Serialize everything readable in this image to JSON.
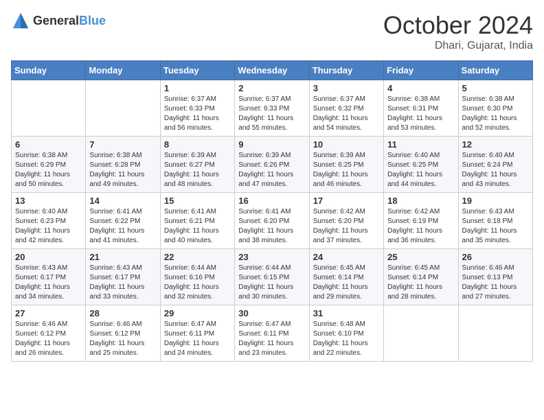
{
  "logo": {
    "text_general": "General",
    "text_blue": "Blue"
  },
  "header": {
    "month": "October 2024",
    "location": "Dhari, Gujarat, India"
  },
  "weekdays": [
    "Sunday",
    "Monday",
    "Tuesday",
    "Wednesday",
    "Thursday",
    "Friday",
    "Saturday"
  ],
  "weeks": [
    [
      {
        "day": "",
        "info": ""
      },
      {
        "day": "",
        "info": ""
      },
      {
        "day": "1",
        "info": "Sunrise: 6:37 AM\nSunset: 6:33 PM\nDaylight: 11 hours and 56 minutes."
      },
      {
        "day": "2",
        "info": "Sunrise: 6:37 AM\nSunset: 6:33 PM\nDaylight: 11 hours and 55 minutes."
      },
      {
        "day": "3",
        "info": "Sunrise: 6:37 AM\nSunset: 6:32 PM\nDaylight: 11 hours and 54 minutes."
      },
      {
        "day": "4",
        "info": "Sunrise: 6:38 AM\nSunset: 6:31 PM\nDaylight: 11 hours and 53 minutes."
      },
      {
        "day": "5",
        "info": "Sunrise: 6:38 AM\nSunset: 6:30 PM\nDaylight: 11 hours and 52 minutes."
      }
    ],
    [
      {
        "day": "6",
        "info": "Sunrise: 6:38 AM\nSunset: 6:29 PM\nDaylight: 11 hours and 50 minutes."
      },
      {
        "day": "7",
        "info": "Sunrise: 6:38 AM\nSunset: 6:28 PM\nDaylight: 11 hours and 49 minutes."
      },
      {
        "day": "8",
        "info": "Sunrise: 6:39 AM\nSunset: 6:27 PM\nDaylight: 11 hours and 48 minutes."
      },
      {
        "day": "9",
        "info": "Sunrise: 6:39 AM\nSunset: 6:26 PM\nDaylight: 11 hours and 47 minutes."
      },
      {
        "day": "10",
        "info": "Sunrise: 6:39 AM\nSunset: 6:25 PM\nDaylight: 11 hours and 46 minutes."
      },
      {
        "day": "11",
        "info": "Sunrise: 6:40 AM\nSunset: 6:25 PM\nDaylight: 11 hours and 44 minutes."
      },
      {
        "day": "12",
        "info": "Sunrise: 6:40 AM\nSunset: 6:24 PM\nDaylight: 11 hours and 43 minutes."
      }
    ],
    [
      {
        "day": "13",
        "info": "Sunrise: 6:40 AM\nSunset: 6:23 PM\nDaylight: 11 hours and 42 minutes."
      },
      {
        "day": "14",
        "info": "Sunrise: 6:41 AM\nSunset: 6:22 PM\nDaylight: 11 hours and 41 minutes."
      },
      {
        "day": "15",
        "info": "Sunrise: 6:41 AM\nSunset: 6:21 PM\nDaylight: 11 hours and 40 minutes."
      },
      {
        "day": "16",
        "info": "Sunrise: 6:41 AM\nSunset: 6:20 PM\nDaylight: 11 hours and 38 minutes."
      },
      {
        "day": "17",
        "info": "Sunrise: 6:42 AM\nSunset: 6:20 PM\nDaylight: 11 hours and 37 minutes."
      },
      {
        "day": "18",
        "info": "Sunrise: 6:42 AM\nSunset: 6:19 PM\nDaylight: 11 hours and 36 minutes."
      },
      {
        "day": "19",
        "info": "Sunrise: 6:43 AM\nSunset: 6:18 PM\nDaylight: 11 hours and 35 minutes."
      }
    ],
    [
      {
        "day": "20",
        "info": "Sunrise: 6:43 AM\nSunset: 6:17 PM\nDaylight: 11 hours and 34 minutes."
      },
      {
        "day": "21",
        "info": "Sunrise: 6:43 AM\nSunset: 6:17 PM\nDaylight: 11 hours and 33 minutes."
      },
      {
        "day": "22",
        "info": "Sunrise: 6:44 AM\nSunset: 6:16 PM\nDaylight: 11 hours and 32 minutes."
      },
      {
        "day": "23",
        "info": "Sunrise: 6:44 AM\nSunset: 6:15 PM\nDaylight: 11 hours and 30 minutes."
      },
      {
        "day": "24",
        "info": "Sunrise: 6:45 AM\nSunset: 6:14 PM\nDaylight: 11 hours and 29 minutes."
      },
      {
        "day": "25",
        "info": "Sunrise: 6:45 AM\nSunset: 6:14 PM\nDaylight: 11 hours and 28 minutes."
      },
      {
        "day": "26",
        "info": "Sunrise: 6:46 AM\nSunset: 6:13 PM\nDaylight: 11 hours and 27 minutes."
      }
    ],
    [
      {
        "day": "27",
        "info": "Sunrise: 6:46 AM\nSunset: 6:12 PM\nDaylight: 11 hours and 26 minutes."
      },
      {
        "day": "28",
        "info": "Sunrise: 6:46 AM\nSunset: 6:12 PM\nDaylight: 11 hours and 25 minutes."
      },
      {
        "day": "29",
        "info": "Sunrise: 6:47 AM\nSunset: 6:11 PM\nDaylight: 11 hours and 24 minutes."
      },
      {
        "day": "30",
        "info": "Sunrise: 6:47 AM\nSunset: 6:11 PM\nDaylight: 11 hours and 23 minutes."
      },
      {
        "day": "31",
        "info": "Sunrise: 6:48 AM\nSunset: 6:10 PM\nDaylight: 11 hours and 22 minutes."
      },
      {
        "day": "",
        "info": ""
      },
      {
        "day": "",
        "info": ""
      }
    ]
  ]
}
